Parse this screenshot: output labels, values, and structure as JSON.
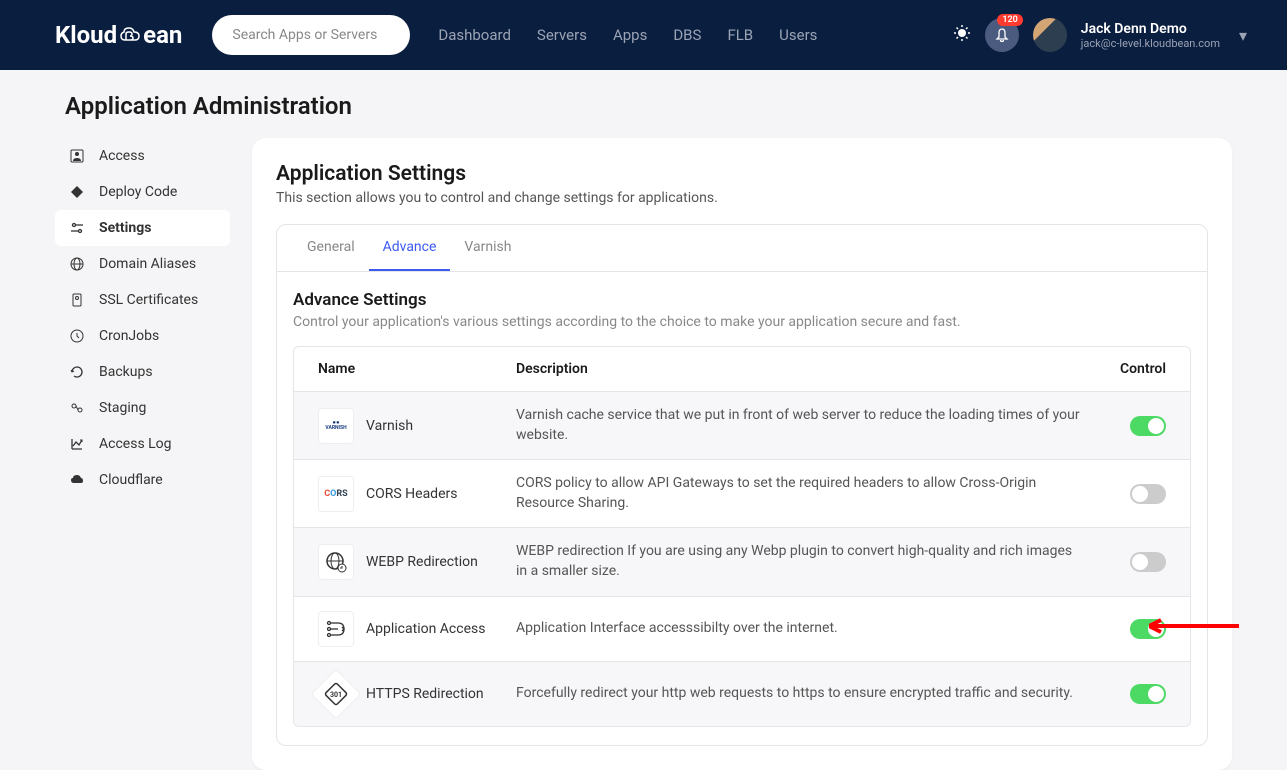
{
  "header": {
    "logo_text_1": "Kloud",
    "logo_text_2": "ean",
    "search_placeholder": "Search Apps or Servers",
    "nav": [
      "Dashboard",
      "Servers",
      "Apps",
      "DBS",
      "FLB",
      "Users"
    ],
    "badge_count": "120",
    "user_name": "Jack Denn Demo",
    "user_email": "jack@c-level.kloudbean.com"
  },
  "page_title": "Application Administration",
  "sidebar": {
    "items": [
      {
        "label": "Access",
        "icon": "user"
      },
      {
        "label": "Deploy Code",
        "icon": "diamond"
      },
      {
        "label": "Settings",
        "icon": "settings",
        "active": true
      },
      {
        "label": "Domain Aliases",
        "icon": "globe"
      },
      {
        "label": "SSL Certificates",
        "icon": "cert"
      },
      {
        "label": "CronJobs",
        "icon": "clock"
      },
      {
        "label": "Backups",
        "icon": "refresh"
      },
      {
        "label": "Staging",
        "icon": "staging"
      },
      {
        "label": "Access Log",
        "icon": "chart"
      },
      {
        "label": "Cloudflare",
        "icon": "cloud"
      }
    ]
  },
  "content": {
    "title": "Application Settings",
    "subtitle": "This section allows you to control and change settings for applications.",
    "tabs": [
      {
        "label": "General"
      },
      {
        "label": "Advance",
        "active": true
      },
      {
        "label": "Varnish"
      }
    ],
    "inner_title": "Advance Settings",
    "inner_subtitle": "Control your application's various settings according to the choice to make your application secure and fast.",
    "table_headers": {
      "name": "Name",
      "desc": "Description",
      "control": "Control"
    },
    "rows": [
      {
        "name": "Varnish",
        "desc": "Varnish cache service that we put in front of web server to reduce the loading times of your website.",
        "on": true,
        "icon_text": "●"
      },
      {
        "name": "CORS Headers",
        "desc": "CORS policy to allow API Gateways to set the required headers to allow Cross-Origin Resource Sharing.",
        "on": false,
        "icon_text": "CORS"
      },
      {
        "name": "WEBP Redirection",
        "desc": "WEBP redirection If you are using any Webp plugin to convert high-quality and rich images in a smaller size.",
        "on": false,
        "icon_text": "🌐"
      },
      {
        "name": "Application Access",
        "desc": "Application Interface accesssibilty over the internet.",
        "on": true,
        "icon_text": "⇄"
      },
      {
        "name": "HTTPS Redirection",
        "desc": "Forcefully redirect your http web requests to https to ensure encrypted traffic and security.",
        "on": true,
        "icon_text": "◈"
      }
    ]
  }
}
